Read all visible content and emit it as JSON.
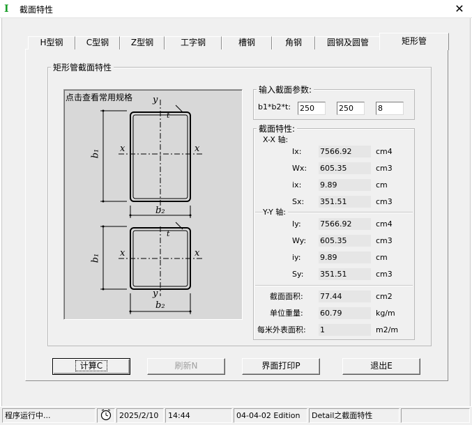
{
  "window": {
    "title": "截面特性",
    "app_icon": "I",
    "close_label": "✕"
  },
  "tabs": [
    {
      "label": "H型钢",
      "active": false
    },
    {
      "label": "C型钢",
      "active": false
    },
    {
      "label": "Z型钢",
      "active": false
    },
    {
      "label": "工字钢",
      "active": false
    },
    {
      "label": "槽钢",
      "active": false
    },
    {
      "label": "角钢",
      "active": false
    },
    {
      "label": "圆钢及圆管",
      "active": false
    },
    {
      "label": "矩形管",
      "active": true
    }
  ],
  "section_group_title": "矩形管截面特性",
  "diagram": {
    "hint": "点击查看常用规格",
    "labels": {
      "y": "y",
      "x": "x",
      "t": "t",
      "b1": "b₁",
      "b2": "b₂"
    }
  },
  "input_group": {
    "title": "输入截面参数:",
    "label": "b1*b2*t:",
    "values": [
      "250",
      "250",
      "8"
    ]
  },
  "props_group": {
    "title": "截面特性:",
    "xx_axis": {
      "title": "X-X 轴:",
      "rows": [
        {
          "label": "Ix:",
          "value": "7566.92",
          "unit": "cm4"
        },
        {
          "label": "Wx:",
          "value": "605.35",
          "unit": "cm3"
        },
        {
          "label": "ix:",
          "value": "9.89",
          "unit": "cm"
        },
        {
          "label": "Sx:",
          "value": "351.51",
          "unit": "cm3"
        }
      ]
    },
    "yy_axis": {
      "title": "Y-Y 轴:",
      "rows": [
        {
          "label": "Iy:",
          "value": "7566.92",
          "unit": "cm4"
        },
        {
          "label": "Wy:",
          "value": "605.35",
          "unit": "cm3"
        },
        {
          "label": "iy:",
          "value": "9.89",
          "unit": "cm"
        },
        {
          "label": "Sy:",
          "value": "351.51",
          "unit": "cm3"
        }
      ]
    },
    "general": [
      {
        "label": "截面面积:",
        "value": "77.44",
        "unit": "cm2"
      },
      {
        "label": "单位重量:",
        "value": "60.79",
        "unit": "kg/m"
      },
      {
        "label": "每米外表面积:",
        "value": "1",
        "unit": "m2/m"
      }
    ]
  },
  "buttons": {
    "calc": "计算C",
    "refresh": "刷新N",
    "print": "界面打印P",
    "exit": "退出E"
  },
  "statusbar": {
    "status": "程序运行中...",
    "icon": "clock-icon",
    "date": "2025/2/10",
    "time": "14:44",
    "edition": "04-04-02 Edition",
    "detail": "Detail之截面特性"
  }
}
